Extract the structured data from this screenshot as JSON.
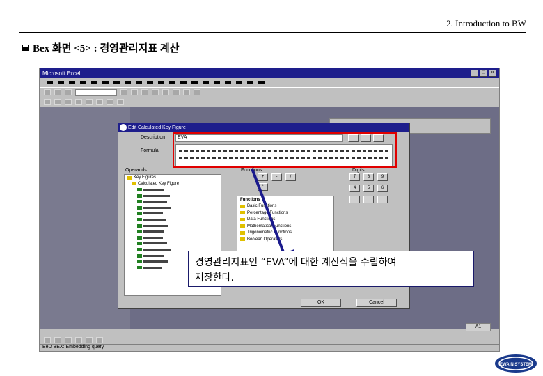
{
  "header": {
    "title": "2. Introduction to BW"
  },
  "slide": {
    "heading": "Bex 화면 <5> : 경영관리지표 계산"
  },
  "excel": {
    "window_title": "Microsoft Excel",
    "dialog": {
      "title": "Edit Calculated Key Figure",
      "description_label": "Description",
      "description_value": "EVA",
      "formula_label": "Formula",
      "operands_label": "Operands",
      "functions_label": "Functions",
      "digits_label": "Digits",
      "functions_header": "Functions",
      "functions": [
        "Basic Functions",
        "Percentage Functions",
        "Data Functions",
        "Mathematical Functions",
        "Trigonometric Functions",
        "Boolean Operators"
      ],
      "tree_root": "Key Figures",
      "tree_child": "Calculated Key Figure",
      "digits": [
        "7",
        "8",
        "9",
        "4",
        "5",
        "6"
      ],
      "ok_label": "OK",
      "cancel_label": "Cancel"
    },
    "corner_button": "A1",
    "statusbar": "BeD BEX: Embedding query"
  },
  "callout": {
    "line1": "경영관리지표인 “EVA”에 대한 계산식을 수립하여",
    "line2": "저장한다."
  },
  "logo": {
    "text": "EWAIN SYSTEM"
  },
  "colors": {
    "accent": "#1e1e8c",
    "highlight": "#e00000",
    "arrow": "#1a1a8c"
  }
}
